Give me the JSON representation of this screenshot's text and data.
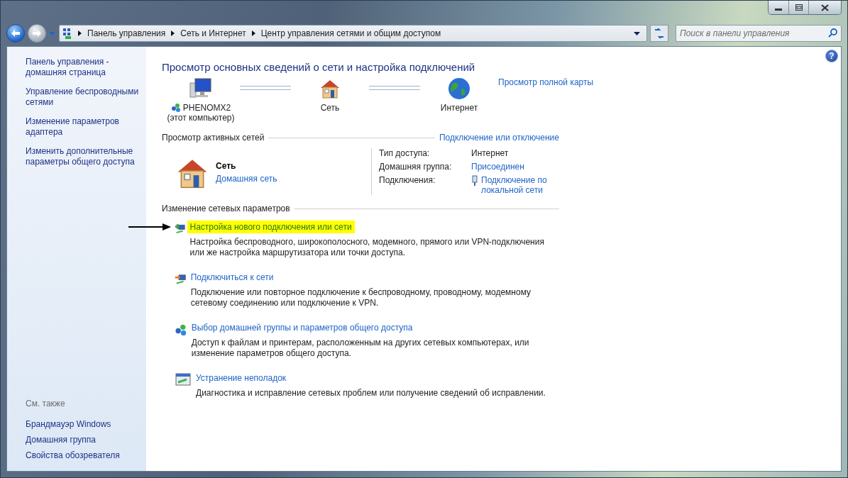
{
  "help": "?",
  "address_bar": {
    "crumbs": [
      "Панель управления",
      "Сеть и Интернет",
      "Центр управления сетями и общим доступом"
    ]
  },
  "search": {
    "placeholder": "Поиск в панели управления"
  },
  "sidebar": {
    "items": [
      "Панель управления - домашняя страница",
      "Управление беспроводными сетями",
      "Изменение параметров адаптера",
      "Изменить дополнительные параметры общего доступа"
    ],
    "see_also": {
      "heading": "См. также",
      "items": [
        "Брандмауэр Windows",
        "Домашняя группа",
        "Свойства обозревателя"
      ]
    }
  },
  "main": {
    "title": "Просмотр основных сведений о сети и настройка подключений",
    "map": {
      "nodes": [
        {
          "kind": "computer",
          "label": "PHENOMX2",
          "sublabel": "(этот компьютер)"
        },
        {
          "kind": "house",
          "label": "Сеть"
        },
        {
          "kind": "globe",
          "label": "Интернет"
        }
      ],
      "link": "Просмотр полной карты"
    },
    "active_networks": {
      "heading": "Просмотр активных сетей",
      "link": "Подключение или отключение",
      "network": {
        "name": "Сеть",
        "type": "Домашняя сеть"
      },
      "properties": [
        {
          "label": "Тип доступа:",
          "value": "Интернет",
          "kind": "text"
        },
        {
          "label": "Домашняя группа:",
          "value": "Присоединен",
          "kind": "link"
        },
        {
          "label": "Подключения:",
          "value": "Подключение по локальной сети",
          "kind": "connection"
        }
      ]
    },
    "change_settings": {
      "heading": "Изменение сетевых параметров",
      "tasks": [
        {
          "kind": "new-connection",
          "title": "Настройка нового подключения или сети",
          "description": "Настройка беспроводного, широкополосного, модемного, прямого или VPN-подключения или же настройка маршрутизатора или точки доступа.",
          "highlighted": true
        },
        {
          "kind": "connect",
          "title": "Подключиться к сети",
          "description": "Подключение или повторное подключение к беспроводному, проводному, модемному сетевому соединению или подключение к VPN.",
          "highlighted": false
        },
        {
          "kind": "homegroup",
          "title": "Выбор домашней группы и параметров общего доступа",
          "description": "Доступ к файлам и принтерам, расположенным на других сетевых компьютерах, или изменение параметров общего доступа.",
          "highlighted": false
        },
        {
          "kind": "troubleshoot",
          "title": "Устранение неполадок",
          "description": "Диагностика и исправление сетевых проблем или получение сведений об исправлении.",
          "highlighted": false
        }
      ]
    }
  }
}
